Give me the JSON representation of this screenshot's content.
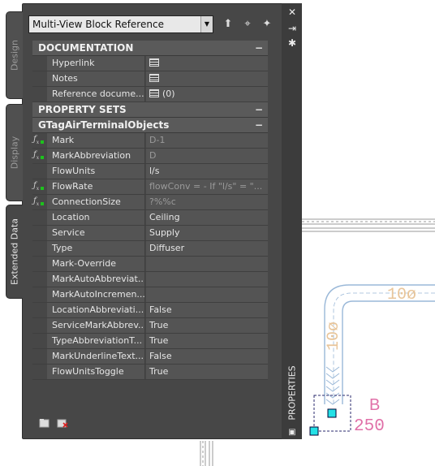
{
  "palette": {
    "title": "PROPERTIES",
    "object_select": "Multi-View Block Reference",
    "tabs": [
      "Design",
      "Display",
      "Extended Data"
    ],
    "active_tab": "Extended Data"
  },
  "sections": [
    {
      "title": "DOCUMENTATION",
      "collapse": "−"
    },
    {
      "title": "PROPERTY SETS",
      "collapse": "−"
    },
    {
      "title": "GTagAirTerminalObjects",
      "collapse": "−"
    }
  ],
  "documentation": [
    {
      "name": "Hyperlink",
      "value": ""
    },
    {
      "name": "Notes",
      "value": ""
    },
    {
      "name": "Reference docume...",
      "value": "(0)"
    }
  ],
  "properties": [
    {
      "name": "Mark",
      "value": "D-1",
      "fx": true,
      "grey": true
    },
    {
      "name": "MarkAbbreviation",
      "value": "D",
      "fx": true,
      "grey": true
    },
    {
      "name": "FlowUnits",
      "value": "l/s",
      "fx": false,
      "grey": false
    },
    {
      "name": "FlowRate",
      "value": "flowConv = - If \"l/s\" = \"...",
      "fx": true,
      "grey": true
    },
    {
      "name": "ConnectionSize",
      "value": "?%%c",
      "fx": true,
      "grey": true
    },
    {
      "name": "Location",
      "value": "Ceiling",
      "fx": false,
      "grey": false
    },
    {
      "name": "Service",
      "value": "Supply",
      "fx": false,
      "grey": false
    },
    {
      "name": "Type",
      "value": "Diffuser",
      "fx": false,
      "grey": false
    },
    {
      "name": "Mark-Override",
      "value": "",
      "fx": false,
      "grey": false
    },
    {
      "name": "MarkAutoAbbreviat...",
      "value": "",
      "fx": false,
      "grey": false
    },
    {
      "name": "MarkAutoIncremen...",
      "value": "",
      "fx": false,
      "grey": false
    },
    {
      "name": "LocationAbbreviati...",
      "value": "False",
      "fx": false,
      "grey": false
    },
    {
      "name": "ServiceMarkAbbrev...",
      "value": "True",
      "fx": false,
      "grey": false
    },
    {
      "name": "TypeAbbreviationT...",
      "value": "True",
      "fx": false,
      "grey": false
    },
    {
      "name": "MarkUnderlineText...",
      "value": "False",
      "fx": false,
      "grey": false
    },
    {
      "name": "FlowUnitsToggle",
      "value": "True",
      "fx": false,
      "grey": false
    }
  ],
  "drawing": {
    "duct_label_horizontal": "10ø",
    "duct_label_vertical": "10ø",
    "tag_letter": "B",
    "tag_value": "250",
    "duct_color": "#e8c59a",
    "tag_color": "#e070a8",
    "grip_color": "#24e1e6"
  },
  "icons": {
    "close": "close-icon",
    "autohide": "autohide-icon",
    "settings": "settings-icon",
    "toggle_pickadd": "pickadd-icon",
    "select_objects": "select-objects-icon",
    "quick_select": "quick-select-icon"
  }
}
